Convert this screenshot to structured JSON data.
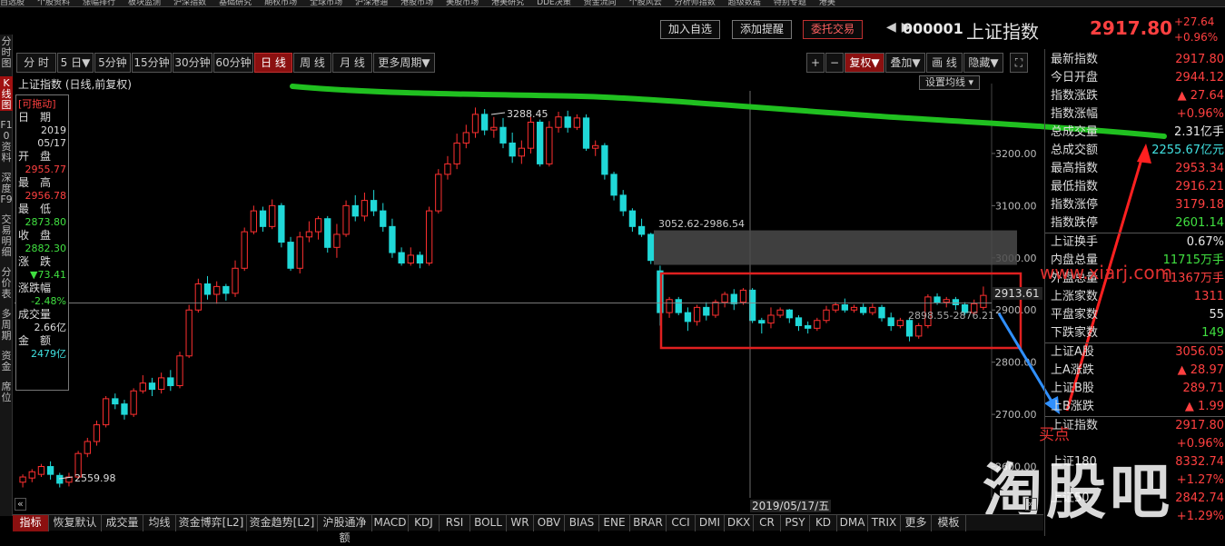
{
  "top_menu": [
    "自选股",
    "个股资料",
    "涨幅排行",
    "板块监测",
    "沪深指数",
    "基础研究",
    "期权市场",
    "全球市场",
    "沪深港通",
    "港股市场",
    "美股市场",
    "港美研究",
    "DDE决策",
    "资金流向",
    "个股风云",
    "分析师指数",
    "超级数据",
    "特别专题",
    "港美"
  ],
  "left_strip": [
    "分时图",
    "K线图",
    "F10资料",
    "深度F9",
    "交易明细",
    "分价表",
    "多周期",
    "资金",
    "席位"
  ],
  "actions": {
    "add_watch": "加入自选",
    "add_alert": "添加提醒",
    "entrust_trade": "委托交易"
  },
  "stock": {
    "code": "000001",
    "name": "上证指数",
    "price": "2917.80",
    "change": "+27.64",
    "change_pct": "+0.96%"
  },
  "periods": [
    "分 时",
    "5 日▼",
    "5分钟",
    "15分钟",
    "30分钟",
    "60分钟",
    "日 线",
    "周 线",
    "月 线",
    "更多周期▼"
  ],
  "tools": [
    "+",
    "−",
    "复权▼",
    "叠加▼",
    "画 线",
    "隐藏▼"
  ],
  "chart_title": "上证指数 (日线,前复权)",
  "ma_setting": "设置均线 ▾",
  "info": {
    "drag": "[可拖动]",
    "date_label": "日　期",
    "year": "2019",
    "day": "05/17",
    "open_label": "开　盘",
    "open": "2955.77",
    "high_label": "最　高",
    "high": "2956.78",
    "low_label": "最　低",
    "low": "2873.80",
    "close_label": "收　盘",
    "close": "2882.30",
    "chg_label": "涨　跌",
    "chg": "▼73.41",
    "chgpct_label": "涨跌幅",
    "chgpct": "-2.48%",
    "vol_label": "成交量",
    "vol": "2.66亿",
    "amt_label": "金　额",
    "amt": "2479亿"
  },
  "annotations": {
    "high": "3288.45",
    "low": "2559.98",
    "range1": "3052.62-2986.54",
    "range2": "2898.55-2876.21"
  },
  "price_tag": "2913.61",
  "date_label": "2019/05/17/五",
  "watermark": "www.xiarj.com",
  "buy_point": "买点",
  "logo": "淘股吧",
  "right_panel": [
    {
      "k": "最新指数",
      "v": "2917.80",
      "c": "#ff4040"
    },
    {
      "k": "今日开盘",
      "v": "2944.12",
      "c": "#ff4040"
    },
    {
      "k": "指数涨跌",
      "v": "▲ 27.64",
      "c": "#ff4040"
    },
    {
      "k": "指数涨幅",
      "v": "+0.96%",
      "c": "#ff4040"
    },
    {
      "k": "总成交量",
      "v": "2.31亿手",
      "c": "#e8e8e8"
    },
    {
      "k": "总成交额",
      "v": "2255.67亿元",
      "c": "#40e0e0"
    },
    {
      "k": "最高指数",
      "v": "2953.34",
      "c": "#ff4040"
    },
    {
      "k": "最低指数",
      "v": "2916.21",
      "c": "#ff4040"
    },
    {
      "k": "指数涨停",
      "v": "3179.18",
      "c": "#ff4040"
    },
    {
      "k": "指数跌停",
      "v": "2601.14",
      "c": "#40e040"
    },
    {
      "k": "上证换手",
      "v": "0.67%",
      "c": "#e8e8e8"
    },
    {
      "k": "内盘总量",
      "v": "11715万手",
      "c": "#40e040"
    },
    {
      "k": "外盘总量",
      "v": "11367万手",
      "c": "#ff4040"
    },
    {
      "k": "上涨家数",
      "v": "1311",
      "c": "#ff4040"
    },
    {
      "k": "平盘家数",
      "v": "55",
      "c": "#e8e8e8"
    },
    {
      "k": "下跌家数",
      "v": "149",
      "c": "#40e040"
    },
    {
      "k": "上证A股",
      "v": "3056.05",
      "c": "#ff4040"
    },
    {
      "k": "上A涨跌",
      "v": "▲ 28.97",
      "c": "#ff4040"
    },
    {
      "k": "上证B股",
      "v": "289.71",
      "c": "#ff4040"
    },
    {
      "k": "上B涨跌",
      "v": "▲ 1.99",
      "c": "#ff4040"
    },
    {
      "k": "上证指数",
      "v": "2917.80",
      "c": "#ff4040"
    },
    {
      "k": "",
      "v": "+0.96%",
      "c": "#ff4040"
    },
    {
      "k": "上证180",
      "v": "8332.74",
      "c": "#ff4040"
    },
    {
      "k": "",
      "v": "+1.27%",
      "c": "#ff4040"
    },
    {
      "k": "上证50",
      "v": "2842.74",
      "c": "#ff4040"
    },
    {
      "k": "",
      "v": "+1.29%",
      "c": "#ff4040"
    }
  ],
  "bottom_tabs": [
    "指标",
    "恢复默认",
    "成交量",
    "均线",
    "资金博弈[L2]",
    "资金趋势[L2]",
    "沪股通净额",
    "MACD",
    "KDJ",
    "RSI",
    "BOLL",
    "WR",
    "OBV",
    "BIAS",
    "ENE",
    "BRAR",
    "CCI",
    "DMI",
    "DKX",
    "CR",
    "PSY",
    "KD",
    "DMA",
    "TRIX",
    "更多",
    "模板"
  ],
  "chart_data": {
    "type": "candlestick",
    "title": "上证指数 (日线,前复权)",
    "ylim": [
      2540,
      3320
    ],
    "yticks": [
      2600,
      2700,
      2800,
      2900,
      3000,
      3100,
      3200
    ],
    "candles": [
      [
        2570,
        2580,
        2560,
        2585
      ],
      [
        2578,
        2590,
        2570,
        2595
      ],
      [
        2585,
        2600,
        2580,
        2605
      ],
      [
        2600,
        2585,
        2575,
        2610
      ],
      [
        2583,
        2568,
        2560,
        2588
      ],
      [
        2570,
        2580,
        2562,
        2588
      ],
      [
        2580,
        2625,
        2576,
        2630
      ],
      [
        2625,
        2648,
        2618,
        2655
      ],
      [
        2648,
        2680,
        2640,
        2688
      ],
      [
        2680,
        2730,
        2675,
        2735
      ],
      [
        2730,
        2720,
        2710,
        2740
      ],
      [
        2720,
        2700,
        2690,
        2728
      ],
      [
        2700,
        2745,
        2695,
        2750
      ],
      [
        2745,
        2760,
        2740,
        2775
      ],
      [
        2760,
        2748,
        2735,
        2770
      ],
      [
        2748,
        2770,
        2740,
        2780
      ],
      [
        2770,
        2755,
        2745,
        2785
      ],
      [
        2755,
        2812,
        2750,
        2820
      ],
      [
        2812,
        2900,
        2808,
        2910
      ],
      [
        2900,
        2950,
        2895,
        2960
      ],
      [
        2950,
        2930,
        2920,
        2965
      ],
      [
        2930,
        2945,
        2912,
        2955
      ],
      [
        2945,
        2932,
        2918,
        2950
      ],
      [
        2932,
        2980,
        2925,
        2995
      ],
      [
        2980,
        3050,
        2975,
        3058
      ],
      [
        3050,
        3090,
        3045,
        3100
      ],
      [
        3090,
        3060,
        3050,
        3098
      ],
      [
        3060,
        3100,
        3055,
        3112
      ],
      [
        3100,
        3030,
        3020,
        3105
      ],
      [
        3030,
        2980,
        2975,
        3040
      ],
      [
        2980,
        3040,
        2970,
        3050
      ],
      [
        3040,
        3050,
        3030,
        3070
      ],
      [
        3050,
        3075,
        3035,
        3080
      ],
      [
        3075,
        3020,
        3010,
        3080
      ],
      [
        3020,
        3045,
        3000,
        3065
      ],
      [
        3045,
        3100,
        3040,
        3110
      ],
      [
        3100,
        3080,
        3070,
        3120
      ],
      [
        3080,
        3110,
        3070,
        3125
      ],
      [
        3110,
        3090,
        3080,
        3130
      ],
      [
        3090,
        3060,
        3050,
        3105
      ],
      [
        3060,
        3010,
        3000,
        3075
      ],
      [
        3010,
        2990,
        2985,
        3020
      ],
      [
        2990,
        3005,
        2985,
        3020
      ],
      [
        3005,
        2990,
        2980,
        3012
      ],
      [
        2990,
        3090,
        2985,
        3098
      ],
      [
        3090,
        3160,
        3085,
        3170
      ],
      [
        3160,
        3180,
        3150,
        3195
      ],
      [
        3180,
        3220,
        3170,
        3238
      ],
      [
        3220,
        3240,
        3210,
        3255
      ],
      [
        3240,
        3275,
        3230,
        3288
      ],
      [
        3275,
        3245,
        3235,
        3285
      ],
      [
        3245,
        3250,
        3230,
        3270
      ],
      [
        3250,
        3220,
        3210,
        3268
      ],
      [
        3220,
        3195,
        3182,
        3240
      ],
      [
        3195,
        3210,
        3180,
        3225
      ],
      [
        3210,
        3260,
        3200,
        3270
      ],
      [
        3260,
        3180,
        3175,
        3265
      ],
      [
        3180,
        3250,
        3175,
        3262
      ],
      [
        3250,
        3270,
        3240,
        3280
      ],
      [
        3270,
        3250,
        3240,
        3282
      ],
      [
        3250,
        3268,
        3245,
        3275
      ],
      [
        3268,
        3210,
        3205,
        3275
      ],
      [
        3210,
        3215,
        3195,
        3225
      ],
      [
        3215,
        3160,
        3150,
        3220
      ],
      [
        3160,
        3120,
        3110,
        3165
      ],
      [
        3120,
        3090,
        3080,
        3130
      ],
      [
        3090,
        3060,
        3050,
        3095
      ],
      [
        3060,
        3045,
        3040,
        3075
      ],
      [
        3045,
        2995,
        2988,
        3048
      ],
      [
        2975,
        2895,
        2870,
        2985
      ],
      [
        2895,
        2920,
        2885,
        2925
      ],
      [
        2920,
        2895,
        2890,
        2925
      ],
      [
        2895,
        2878,
        2860,
        2905
      ],
      [
        2878,
        2905,
        2870,
        2910
      ],
      [
        2905,
        2890,
        2880,
        2915
      ],
      [
        2890,
        2915,
        2885,
        2920
      ],
      [
        2915,
        2930,
        2905,
        2935
      ],
      [
        2930,
        2912,
        2900,
        2940
      ],
      [
        2915,
        2938,
        2910,
        2942
      ],
      [
        2938,
        2880,
        2875,
        2942
      ],
      [
        2880,
        2875,
        2855,
        2885
      ],
      [
        2875,
        2890,
        2865,
        2905
      ],
      [
        2890,
        2900,
        2885,
        2905
      ],
      [
        2900,
        2885,
        2875,
        2902
      ],
      [
        2885,
        2870,
        2860,
        2890
      ],
      [
        2870,
        2865,
        2855,
        2878
      ],
      [
        2865,
        2880,
        2860,
        2885
      ],
      [
        2880,
        2900,
        2875,
        2908
      ],
      [
        2900,
        2910,
        2895,
        2915
      ],
      [
        2910,
        2900,
        2895,
        2922
      ],
      [
        2900,
        2905,
        2895,
        2910
      ],
      [
        2905,
        2895,
        2890,
        2912
      ],
      [
        2895,
        2905,
        2890,
        2912
      ],
      [
        2905,
        2885,
        2878,
        2910
      ],
      [
        2885,
        2870,
        2860,
        2895
      ],
      [
        2870,
        2880,
        2865,
        2885
      ],
      [
        2880,
        2850,
        2840,
        2885
      ],
      [
        2850,
        2870,
        2845,
        2875
      ],
      [
        2870,
        2925,
        2865,
        2930
      ],
      [
        2925,
        2915,
        2910,
        2932
      ],
      [
        2915,
        2920,
        2905,
        2925
      ],
      [
        2920,
        2910,
        2900,
        2925
      ],
      [
        2910,
        2895,
        2890,
        2915
      ],
      [
        2895,
        2912,
        2890,
        2920
      ],
      [
        2905,
        2928,
        2900,
        2945
      ]
    ]
  },
  "colors": {
    "up": "#ff3030",
    "down": "#20d8d8",
    "green_line": "#20c020",
    "red_rect": "#e02020",
    "blue_arrow": "#3090ff",
    "red_arrow": "#ff2020",
    "accent": "#8b1010"
  }
}
